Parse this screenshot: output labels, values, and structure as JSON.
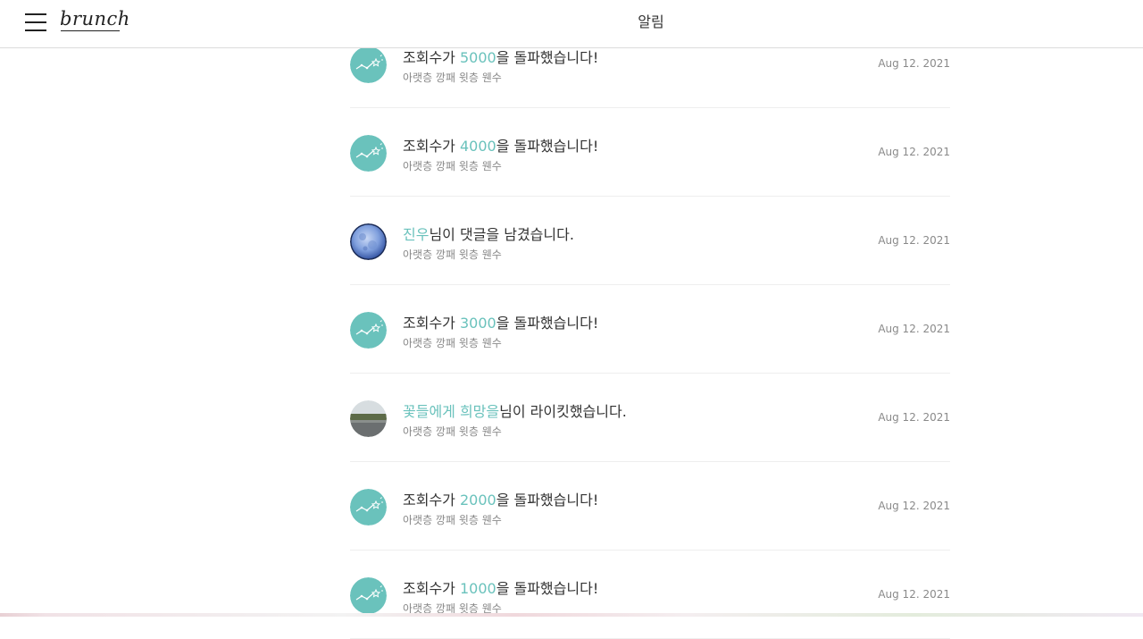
{
  "header": {
    "logo": "brunch",
    "title": "알림"
  },
  "notifications": [
    {
      "type": "views",
      "prefix": "조회수가 ",
      "highlight": "5000",
      "suffix": "을 돌파했습니다!",
      "subtitle": "아랫층 깡패 윗층 웬수",
      "date": "Aug 12. 2021",
      "avatar": "stats-icon"
    },
    {
      "type": "views",
      "prefix": "조회수가 ",
      "highlight": "4000",
      "suffix": "을 돌파했습니다!",
      "subtitle": "아랫층 깡패 윗층 웬수",
      "date": "Aug 12. 2021",
      "avatar": "stats-icon"
    },
    {
      "type": "comment",
      "prefix": "",
      "highlight": "진우",
      "suffix": "님이 댓글을 남겼습니다.",
      "subtitle": "아랫층 깡패 윗층 웬수",
      "date": "Aug 12. 2021",
      "avatar": "moon-avatar"
    },
    {
      "type": "views",
      "prefix": "조회수가 ",
      "highlight": "3000",
      "suffix": "을 돌파했습니다!",
      "subtitle": "아랫층 깡패 윗층 웬수",
      "date": "Aug 12. 2021",
      "avatar": "stats-icon"
    },
    {
      "type": "like",
      "prefix": "",
      "highlight": "꽃들에게 희망을",
      "suffix": "님이 라이킷했습니다.",
      "subtitle": "아랫층 깡패 윗층 웬수",
      "date": "Aug 12. 2021",
      "avatar": "landscape-avatar"
    },
    {
      "type": "views",
      "prefix": "조회수가 ",
      "highlight": "2000",
      "suffix": "을 돌파했습니다!",
      "subtitle": "아랫층 깡패 윗층 웬수",
      "date": "Aug 12. 2021",
      "avatar": "stats-icon"
    },
    {
      "type": "views",
      "prefix": "조회수가 ",
      "highlight": "1000",
      "suffix": "을 돌파했습니다!",
      "subtitle": "아랫층 깡패 윗층 웬수",
      "date": "Aug 12. 2021",
      "avatar": "stats-icon"
    }
  ],
  "colors": {
    "accent": "#6ac2bc",
    "text": "#333333",
    "subtext": "#888888"
  }
}
